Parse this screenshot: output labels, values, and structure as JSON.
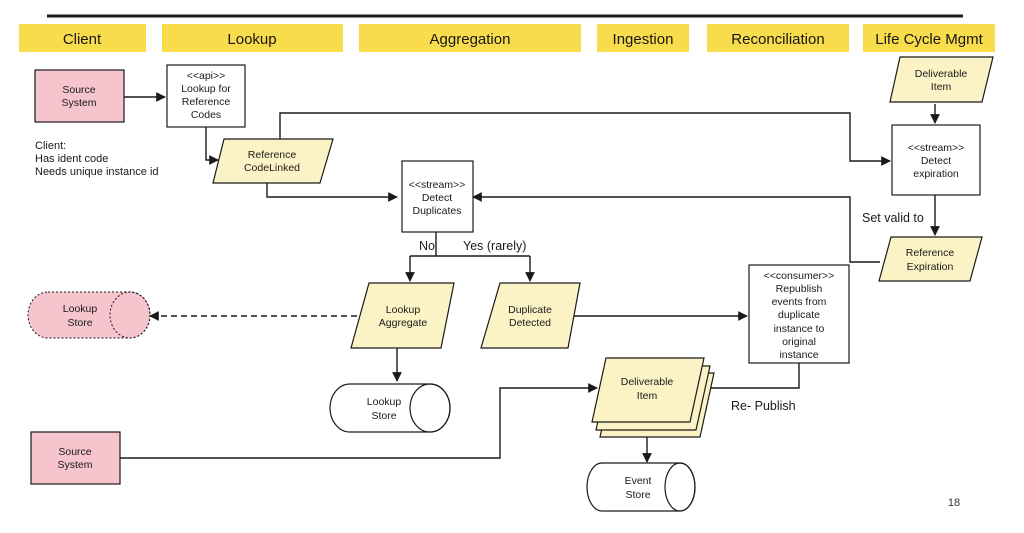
{
  "colors": {
    "lane_header": "#f8dc4b",
    "data_node": "#fbf3c6",
    "source_node": "#f5c4cc",
    "process_node": "#ffffff",
    "line": "#1a1a1a"
  },
  "lanes": [
    {
      "id": "client",
      "label": "Client"
    },
    {
      "id": "lookup",
      "label": "Lookup"
    },
    {
      "id": "aggregation",
      "label": "Aggregation"
    },
    {
      "id": "ingestion",
      "label": "Ingestion"
    },
    {
      "id": "reconciliation",
      "label": "Reconciliation"
    },
    {
      "id": "lifecycle",
      "label": "Life Cycle Mgmt"
    }
  ],
  "nodes": {
    "source_system_top": {
      "type": "source",
      "lines": [
        "Source",
        "System"
      ]
    },
    "lookup_api": {
      "type": "process",
      "lines": [
        "<<api>>",
        "Lookup for",
        "Reference",
        "Codes"
      ]
    },
    "reference_codelinked": {
      "type": "data",
      "lines": [
        "Reference",
        "CodeLinked"
      ]
    },
    "detect_duplicates": {
      "type": "process",
      "lines": [
        "<<stream>>",
        "Detect",
        "Duplicates"
      ]
    },
    "deliverable_item_top": {
      "type": "data",
      "lines": [
        "Deliverable",
        "Item"
      ]
    },
    "detect_expiration": {
      "type": "process",
      "lines": [
        "<<stream>>",
        "Detect",
        "expiration"
      ]
    },
    "reference_expiration": {
      "type": "data",
      "lines": [
        "Reference",
        "Expiration"
      ]
    },
    "lookup_store_external": {
      "type": "store-external",
      "lines": [
        "Lookup",
        "Store"
      ]
    },
    "lookup_aggregate": {
      "type": "data",
      "lines": [
        "Lookup",
        "Aggregate"
      ]
    },
    "duplicate_detected": {
      "type": "data",
      "lines": [
        "Duplicate",
        "Detected"
      ]
    },
    "republish_consumer": {
      "type": "process",
      "lines": [
        "<<consumer>>",
        "Republish",
        "events from",
        "duplicate",
        "instance to",
        "original",
        "instance"
      ]
    },
    "lookup_store": {
      "type": "store",
      "lines": [
        "Lookup",
        "Store"
      ]
    },
    "deliverable_item_stack": {
      "type": "data-stack",
      "lines": [
        "Deliverable",
        "Item"
      ]
    },
    "source_system_bottom": {
      "type": "source",
      "lines": [
        "Source",
        "System"
      ]
    },
    "event_store": {
      "type": "store",
      "lines": [
        "Event",
        "Store"
      ]
    }
  },
  "client_note": [
    "Client:",
    "Has ident code",
    "Needs unique instance id"
  ],
  "edge_labels": {
    "no": "No",
    "yes_rarely": "Yes (rarely)",
    "set_valid_to": "Set valid to",
    "re_publish": "Re- Publish"
  },
  "page_number": "18"
}
